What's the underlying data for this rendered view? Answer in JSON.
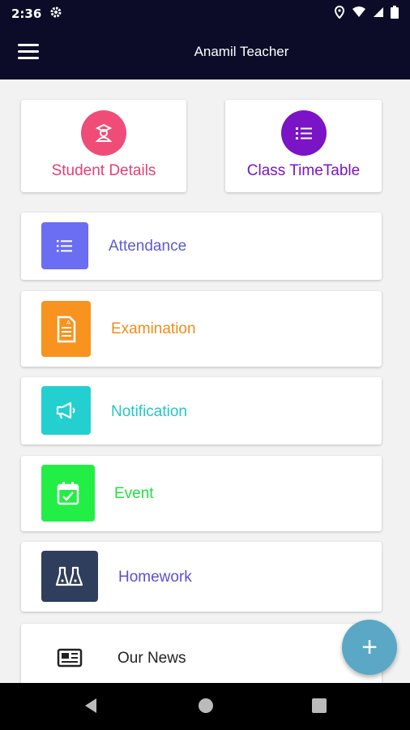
{
  "status_bar": {
    "time": "2:36"
  },
  "app_bar": {
    "title": "Anamil Teacher"
  },
  "top_cards": [
    {
      "label": "Student Details",
      "color": "#e83e72",
      "icon": "student-icon"
    },
    {
      "label": "Class TimeTable",
      "color": "#7a14c6",
      "icon": "list-icon"
    }
  ],
  "menu_items": [
    {
      "label": "Attendance",
      "color": "#5b5bd6",
      "tile_color": "#6b6df2",
      "icon": "list-icon"
    },
    {
      "label": "Examination",
      "color": "#f28c1a",
      "tile_color": "#f7931e",
      "icon": "document-icon"
    },
    {
      "label": "Notification",
      "color": "#22c7c7",
      "tile_color": "#23d0cf",
      "icon": "megaphone-icon"
    },
    {
      "label": "Event",
      "color": "#22e040",
      "tile_color": "#22ee46",
      "icon": "calendar-check-icon"
    },
    {
      "label": "Homework",
      "color": "#5b4fd6",
      "tile_color": "#2e3e5c",
      "icon": "beakers-icon"
    },
    {
      "label": "Our News",
      "color": "#222222",
      "icon": "newspaper-icon"
    }
  ],
  "fab": {
    "label": "+"
  }
}
